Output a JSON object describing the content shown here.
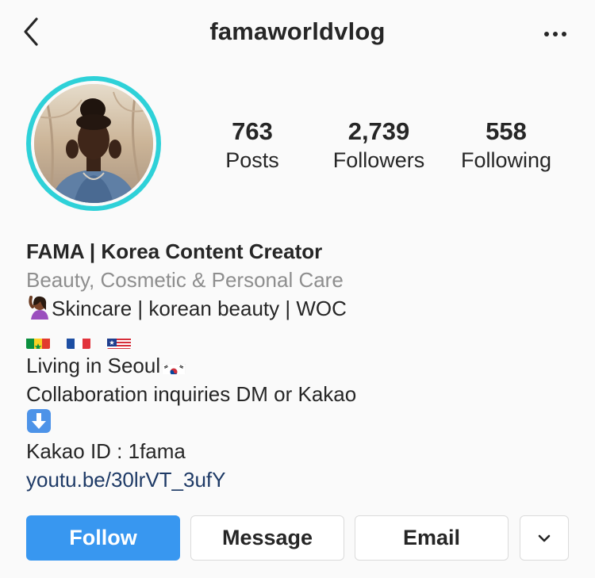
{
  "header": {
    "username": "famaworldvlog",
    "back_icon": "chevron-left-icon",
    "more_icon": "more-horizontal-icon"
  },
  "profile": {
    "avatar_ring_color": "#2ed1d8"
  },
  "stats": {
    "posts": {
      "value": "763",
      "label": "Posts"
    },
    "followers": {
      "value": "2,739",
      "label": "Followers"
    },
    "following": {
      "value": "558",
      "label": "Following"
    }
  },
  "bio": {
    "name": "FAMA | Korea Content Creator",
    "category": "Beauty, Cosmetic & Personal Care",
    "line1": "Skincare | korean beauty | WOC",
    "line1_icon": "woman-raising-hand-icon",
    "flags": [
      "senegal-flag-icon",
      "france-flag-icon",
      "liberia-flag-icon"
    ],
    "line3": "Living in Seoul",
    "line3_icon": "south-korea-flag-icon",
    "line4": "Collaboration inquiries DM or Kakao",
    "line5_icon": "down-arrow-icon",
    "line6": "Kakao ID : 1fama",
    "link": "youtu.be/30lrVT_3ufY"
  },
  "actions": {
    "follow": "Follow",
    "message": "Message",
    "email": "Email",
    "more_icon": "chevron-down-icon"
  },
  "colors": {
    "accent": "#3897f0",
    "link": "#1e3a66",
    "muted": "#8e8e8e"
  }
}
